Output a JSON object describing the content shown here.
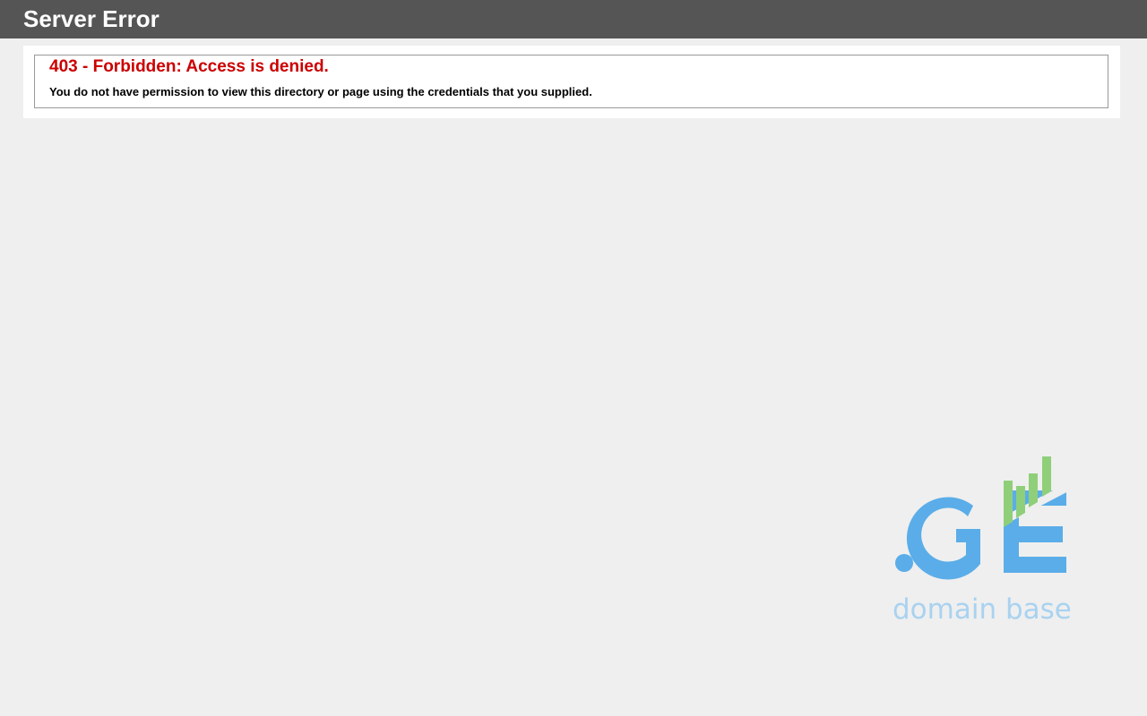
{
  "header": {
    "title": "Server Error"
  },
  "error": {
    "title": "403 - Forbidden: Access is denied.",
    "message": "You do not have permission to view this directory or page using the credentials that you supplied."
  },
  "logo": {
    "mark": ".GE",
    "tagline": "domain base",
    "icon": "domain-base-logo",
    "colors": {
      "blue": "#5aade8",
      "green": "#8fcf7a",
      "tagline": "#a9d2f0"
    }
  },
  "colors": {
    "header_bg": "#555555",
    "page_bg": "#efefef",
    "error_red": "#cc0000"
  }
}
